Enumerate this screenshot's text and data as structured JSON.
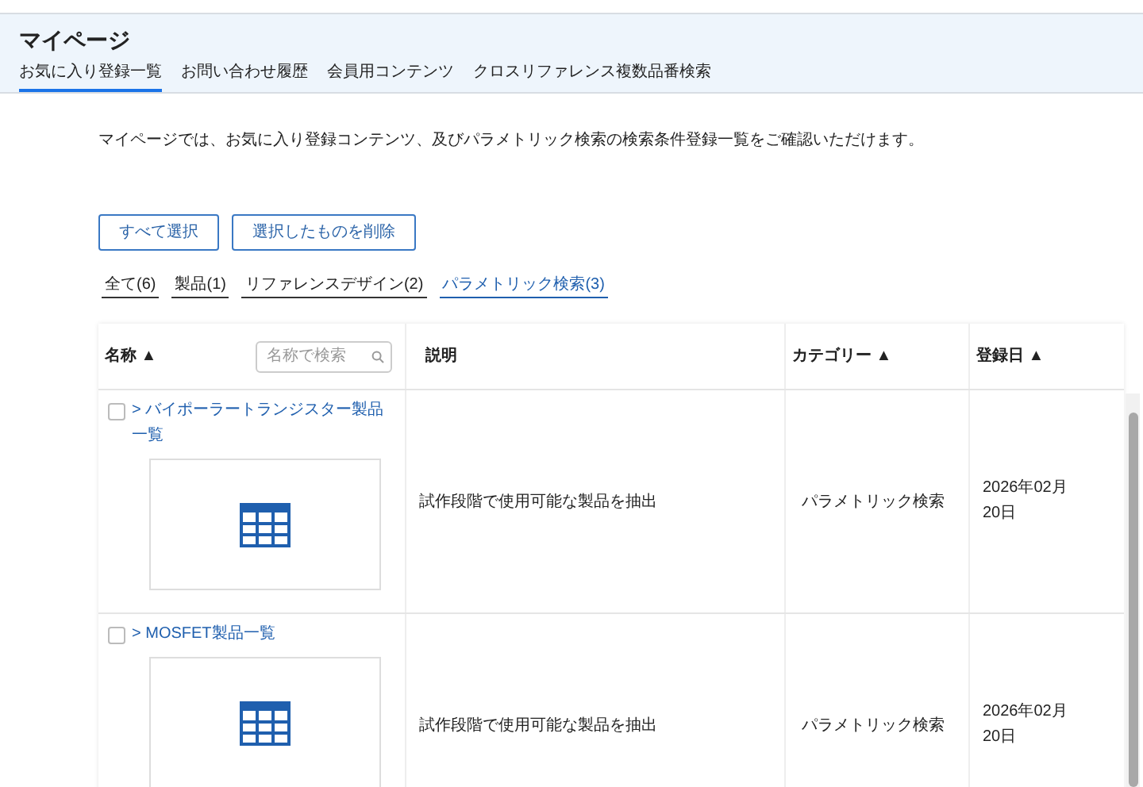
{
  "header": {
    "title": "マイページ",
    "tabs": [
      {
        "label": "お気に入り登録一覧",
        "selected": true
      },
      {
        "label": "お問い合わせ履歴",
        "selected": false
      },
      {
        "label": "会員用コンテンツ",
        "selected": false
      },
      {
        "label": "クロスリファレンス複数品番検索",
        "selected": false
      }
    ]
  },
  "intro": "マイページでは、お気に入り登録コンテンツ、及びパラメトリック検索の検索条件登録一覧をご確認いただけます。",
  "buttons": [
    "すべて選択",
    "選択したものを削除"
  ],
  "filters": [
    {
      "label": "全て(6)",
      "selected": false
    },
    {
      "label": "製品(1)",
      "selected": false
    },
    {
      "label": "リファレンスデザイン(2)",
      "selected": false
    },
    {
      "label": "パラメトリック検索(3)",
      "selected": true
    }
  ],
  "table": {
    "columns": [
      {
        "label": "名称 ▲"
      },
      {
        "label": "説明"
      },
      {
        "label": "カテゴリー ▲"
      },
      {
        "label": "登録日 ▲"
      }
    ],
    "search": {
      "placeholder": "名称で検索"
    },
    "rows": [
      {
        "checked": false,
        "name": "> バイポーラートランジスター製品一覧",
        "description": "試作段階で使用可能な製品を抽出",
        "category": "パラメトリック検索",
        "date": "2026年02月20日"
      },
      {
        "checked": false,
        "name": "> MOSFET製品一覧",
        "description": "試作段階で使用可能な製品を抽出",
        "category": "パラメトリック検索",
        "date": "2026年02月20日"
      }
    ]
  }
}
